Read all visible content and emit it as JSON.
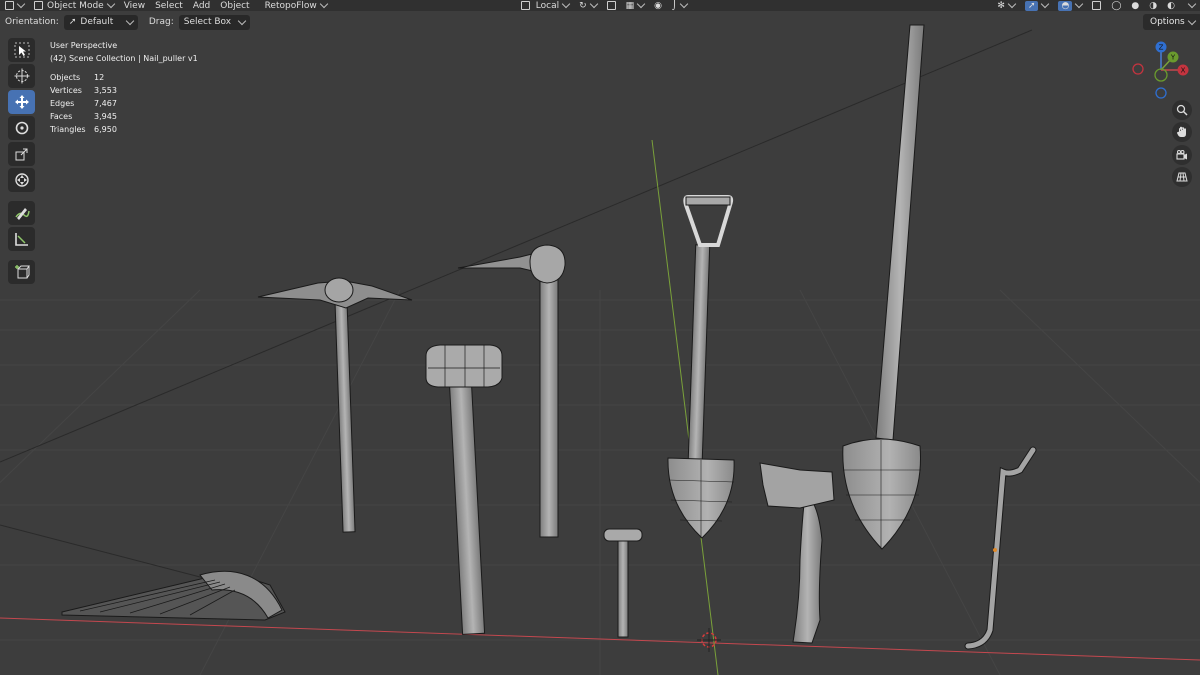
{
  "header": {
    "mode": "Object Mode",
    "menus": [
      "View",
      "Select",
      "Add",
      "Object"
    ],
    "addon": "RetopoFlow",
    "transform_space": "Local"
  },
  "toolbar_row": {
    "orientation_label": "Orientation:",
    "orientation_value": "Default",
    "drag_label": "Drag:",
    "drag_value": "Select Box",
    "options_label": "Options"
  },
  "overlay": {
    "view_name": "User Perspective",
    "collection": "(42) Scene Collection | Nail_puller v1",
    "stats": [
      {
        "label": "Objects",
        "value": "12"
      },
      {
        "label": "Vertices",
        "value": "3,553"
      },
      {
        "label": "Edges",
        "value": "7,467"
      },
      {
        "label": "Faces",
        "value": "3,945"
      },
      {
        "label": "Triangles",
        "value": "6,950"
      }
    ]
  },
  "gizmo": {
    "z": "Z",
    "y": "Y",
    "x": "X"
  },
  "tools": [
    "select-box-tool",
    "cursor-tool",
    "move-tool",
    "rotate-tool",
    "scale-tool",
    "transform-tool",
    "annotate-tool",
    "measure-tool",
    "add-cube-tool"
  ],
  "colors": {
    "viewport": "#3d3d3d",
    "x_axis": "#c4484f",
    "y_axis": "#7aa13a",
    "active_tool": "#4772b3",
    "wire": "#1a1a1a",
    "mesh": "#9a9a9a"
  }
}
